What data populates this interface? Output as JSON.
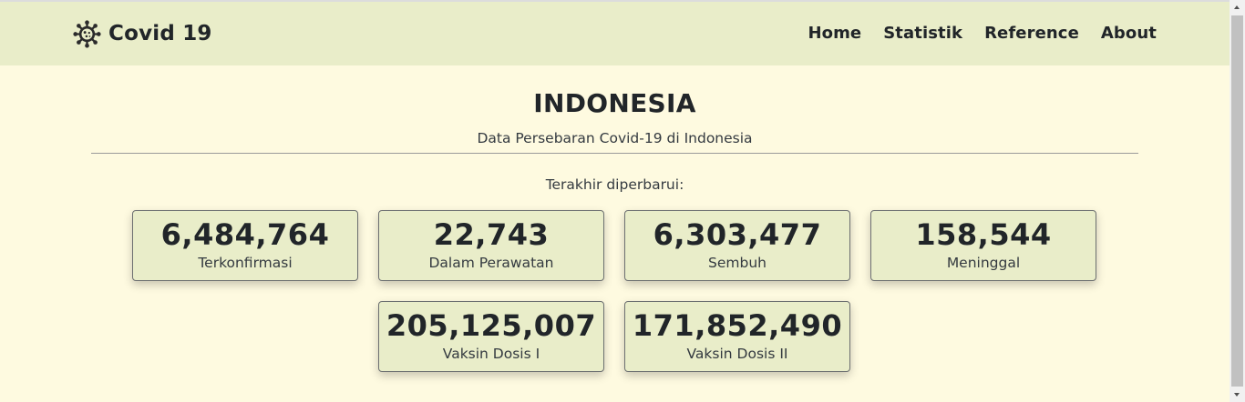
{
  "navbar": {
    "brand_icon": "virus-icon",
    "brand_text": "Covid 19",
    "links": [
      "Home",
      "Statistik",
      "Reference",
      "About"
    ]
  },
  "main": {
    "title": "INDONESIA",
    "subtitle": "Data Persebaran Covid-19 di Indonesia",
    "updated_label": "Terakhir diperbarui:",
    "stats": [
      {
        "value": "6,484,764",
        "label": "Terkonfirmasi"
      },
      {
        "value": "22,743",
        "label": "Dalam Perawatan"
      },
      {
        "value": "6,303,477",
        "label": "Sembuh"
      },
      {
        "value": "158,544",
        "label": "Meninggal"
      },
      {
        "value": "205,125,007",
        "label": "Vaksin Dosis I"
      },
      {
        "value": "171,852,490",
        "label": "Vaksin Dosis II"
      }
    ]
  },
  "colors": {
    "page_background": "#fefae0",
    "navbar_background": "#e9edc9",
    "card_background": "#e9edc9",
    "text": "#212529"
  }
}
